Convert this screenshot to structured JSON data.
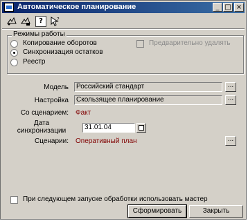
{
  "window": {
    "title": "Автоматическое планирование",
    "minimize_glyph": "_",
    "maximize_glyph": "□",
    "close_glyph": "×"
  },
  "toolbar": {
    "icons": [
      "run-icon",
      "settings-icon",
      "help-icon",
      "context-help-icon"
    ],
    "help_glyph": "?"
  },
  "modes": {
    "label": "Режимы работы",
    "options": [
      "Копирование оборотов",
      "Синхронизация остатков",
      "Реестр"
    ],
    "selected_index": 1,
    "preliminary_delete_label": "Предварительно удалять"
  },
  "form": {
    "model_label": "Модель",
    "model_value": "Российский стандарт",
    "setup_label": "Настройка",
    "setup_value": "Скользящее планирование",
    "with_scenario_label": "Со сценарием:",
    "with_scenario_value": "Факт",
    "sync_date_label_line1": "Дата",
    "sync_date_label_line2": "синхронизации",
    "sync_date_value": "31.01.04",
    "scenarios_label": "Сценарии:",
    "scenarios_value": "Оперативный план",
    "dots": "..."
  },
  "footer": {
    "use_master_label": "При следующем запуске обработки использовать мастер",
    "generate_button": "Сформировать",
    "close_button": "Закрыть"
  }
}
